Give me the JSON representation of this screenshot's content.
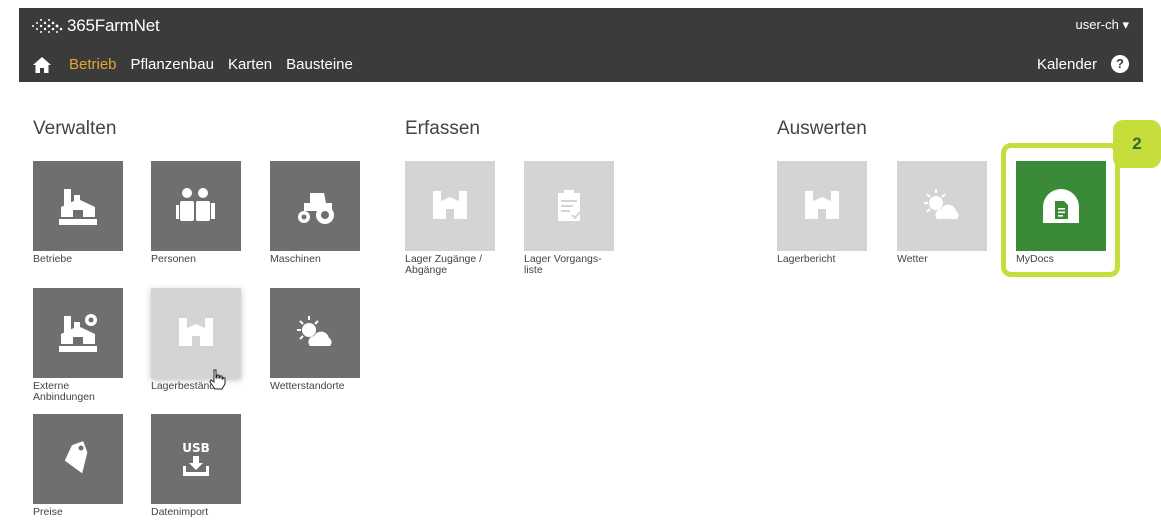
{
  "header": {
    "logo_text": "365FarmNet",
    "user": "user-ch",
    "nav": [
      "Betrieb",
      "Pflanzenbau",
      "Karten",
      "Bausteine"
    ],
    "active_nav": "Betrieb",
    "kalender": "Kalender",
    "help": "?"
  },
  "sections": {
    "verwalten": "Verwalten",
    "erfassen": "Erfassen",
    "auswerten": "Auswerten"
  },
  "tiles": {
    "betriebe": "Betriebe",
    "personen": "Personen",
    "maschinen": "Maschinen",
    "externe": "Externe\nAnbindungen",
    "lagerbestaende": "Lagerbestände",
    "wetterstandorte": "Wetterstandorte",
    "preise": "Preise",
    "datenimport": "Datenimport",
    "lager_zugaenge": "Lager Zugänge /\nAbgänge",
    "lager_vorgangsliste": "Lager Vorgangs-\nliste",
    "lagerbericht": "Lagerbericht",
    "wetter": "Wetter",
    "mydocs": "MyDocs"
  },
  "callout_number": "2",
  "colors": {
    "header_bg": "#3b3b3b",
    "active_nav": "#e2a834",
    "tile_dark": "#6f6f6f",
    "tile_light": "#d4d4d4",
    "tile_green": "#3a8a37",
    "highlight": "#c6dd3c"
  }
}
